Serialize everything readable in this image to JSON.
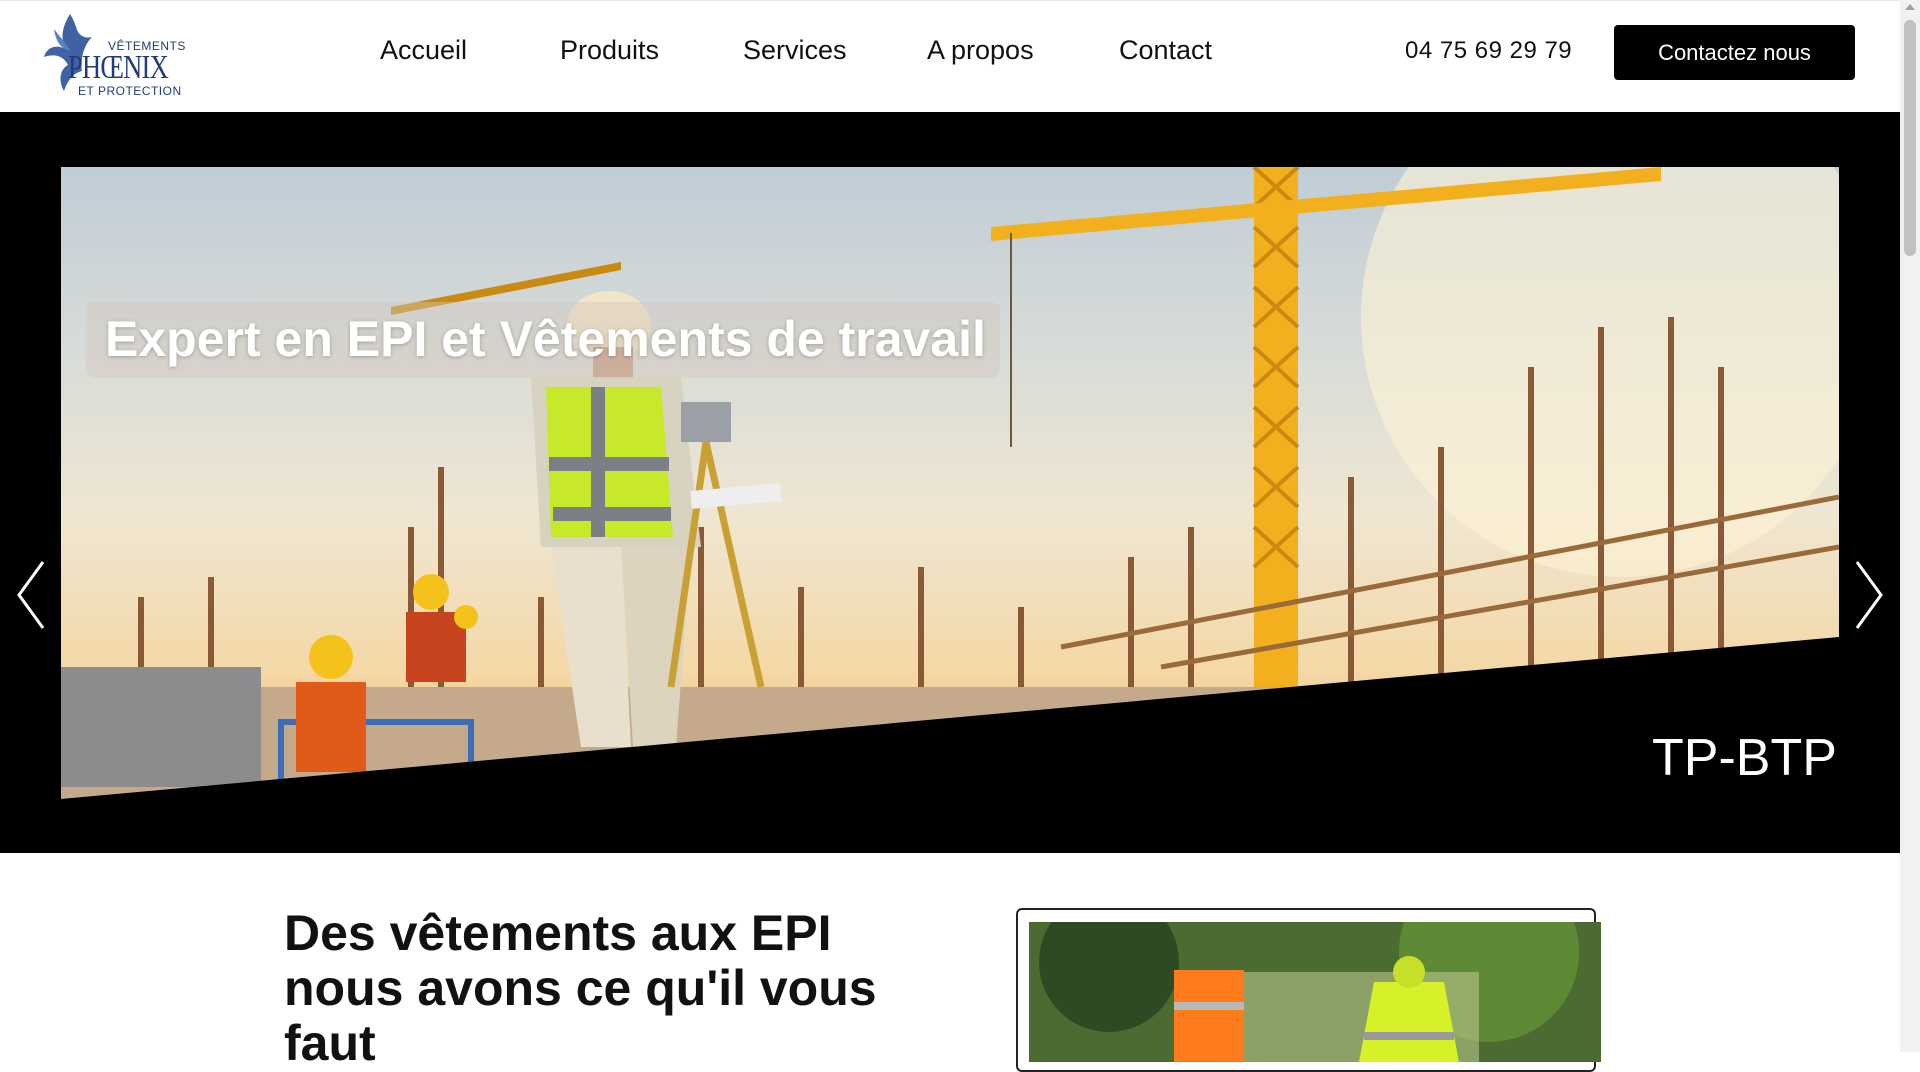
{
  "brand": {
    "logo_line1": "VÊTEMENTS",
    "logo_line2": "PHŒNIX",
    "logo_line3": "ET PROTECTION",
    "color": "#1f3d7a"
  },
  "nav": {
    "items": [
      "Accueil",
      "Produits",
      "Services",
      "A propos",
      "Contact"
    ]
  },
  "header": {
    "phone": "04 75 69 29 79",
    "cta_label": "Contactez nous"
  },
  "hero": {
    "title": "Expert en EPI et Vêtements de travail",
    "caption": "TP-BTP",
    "prev_icon": "chevron-left-icon",
    "next_icon": "chevron-right-icon"
  },
  "section": {
    "title": "Des vêtements aux EPI nous avons ce qu'il vous faut"
  },
  "colors": {
    "hero_bg": "#000000",
    "cta_bg": "#000000",
    "vest": "#c8e82a",
    "crane": "#f2b01e"
  }
}
